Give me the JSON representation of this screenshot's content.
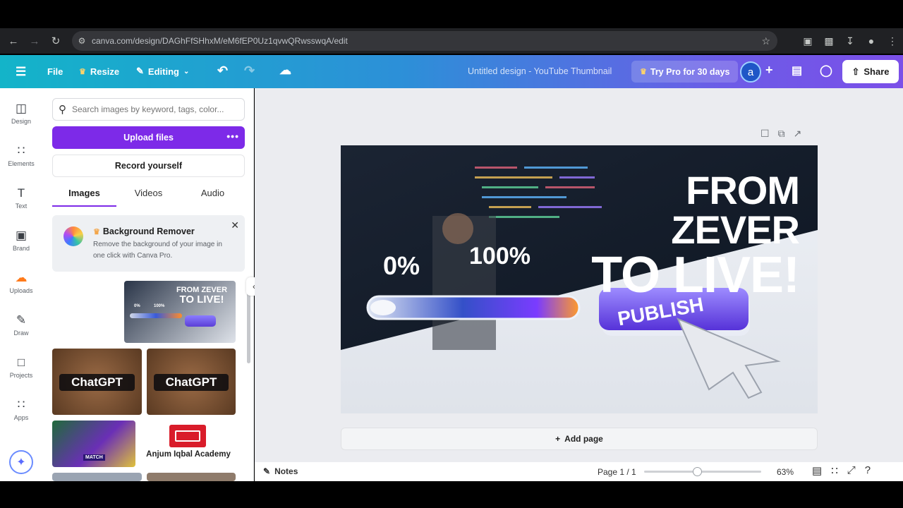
{
  "browser": {
    "url": "canva.com/design/DAGhFfSHhxM/eM6fEP0Uz1qvwQRwsswqA/edit"
  },
  "header": {
    "file_label": "File",
    "resize_label": "Resize",
    "editing_label": "Editing",
    "doc_title": "Untitled design - YouTube Thumbnail",
    "try_pro_label": "Try Pro for 30 days",
    "avatar_initial": "a",
    "share_label": "Share"
  },
  "rail": {
    "items": [
      {
        "label": "Design"
      },
      {
        "label": "Elements"
      },
      {
        "label": "Text"
      },
      {
        "label": "Brand"
      },
      {
        "label": "Uploads"
      },
      {
        "label": "Draw"
      },
      {
        "label": "Projects"
      },
      {
        "label": "Apps"
      }
    ]
  },
  "panel": {
    "search_placeholder": "Search images by keyword, tags, color...",
    "upload_label": "Upload files",
    "upload_more": "•••",
    "record_label": "Record yourself",
    "tabs": [
      {
        "label": "Images"
      },
      {
        "label": "Videos"
      },
      {
        "label": "Audio"
      }
    ],
    "promo": {
      "title": "Background Remover",
      "desc": "Remove the background of your image in one click with Canva Pro."
    },
    "thumbs": {
      "design_line1": "FROM ZEVER",
      "design_line2": "TO LIVE!",
      "design_pct1": "0%",
      "design_pct2": "100%",
      "chatgpt_1": "ChatGPT",
      "chatgpt_2": "ChatGPT",
      "cricket_label": "MATCH",
      "academy_label": "Anjum Iqbal Academy"
    }
  },
  "design": {
    "line1": "FROM ZEVER",
    "line2": "TO LIVE!",
    "pct_start": "0%",
    "pct_end": "100%",
    "button_label": "PUBLISH",
    "add_page_label": "Add page"
  },
  "footer": {
    "notes_label": "Notes",
    "page_indicator": "Page 1 / 1",
    "zoom_level": "63%",
    "zoom_fraction": 0.45
  },
  "colors": {
    "accent": "#7d2ae8",
    "uploads_active": "#ff7a1a"
  }
}
